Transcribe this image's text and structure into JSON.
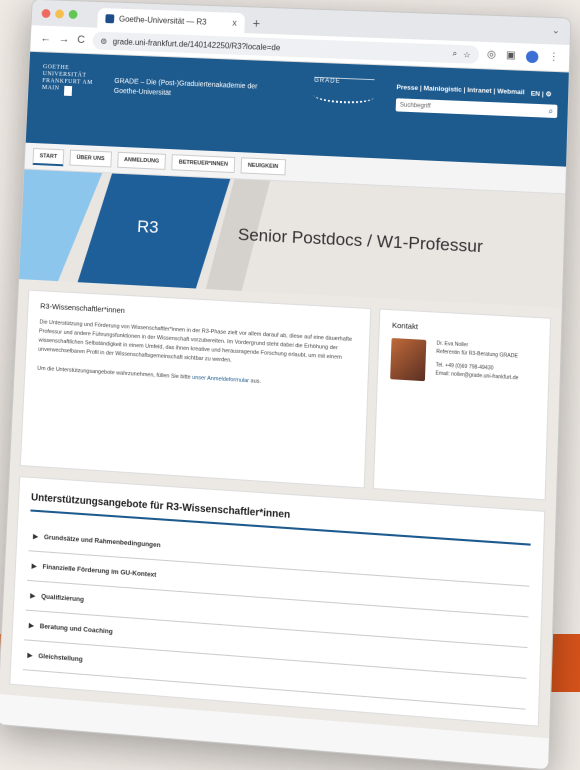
{
  "browser": {
    "tab_title": "Goethe-Universität — R3",
    "tab_close": "x",
    "new_tab": "+",
    "url": "grade.uni-frankfurt.de/140142250/R3?locale=de",
    "nav_icons": [
      "←",
      "→",
      "C"
    ]
  },
  "header": {
    "logo_text": "GOETHE UNIVERSITÄT FRANKFURT AM MAIN",
    "site_title": "GRADE – Die (Post-)Graduiertenakademie der Goethe-Universität",
    "grade_logo": "GRADE",
    "top_links": "Presse | Mainlogistic | Intranet | Webmail",
    "lang": "EN | ⚙",
    "search_placeholder": "Suchbegriff"
  },
  "nav": {
    "items": [
      "START",
      "ÜBER UNS",
      "ANMELDUNG",
      "BETREUER*INNEN",
      "NEUIGKEIN"
    ]
  },
  "hero": {
    "code": "R3",
    "title": "Senior Postdocs / W1-Professur"
  },
  "main": {
    "heading": "R3-Wissenschaftler*innen",
    "paragraph": "Die Unterstützung und Förderung von Wissenschaftler*innen in der R3-Phase zielt vor allem darauf ab, diese auf eine dauerhafte Professur und andere Führungsfunktionen in der Wissenschaft vorzubereiten. Im Vordergrund steht dabei die Erhöhung der wissenschaftlichen Selbständigkeit in einem Umfeld, das ihnen kreative und herausragende Forschung erlaubt, um mit einem unverwechselbaren Profil in der Wissenschaftsgemeinschaft sichtbar zu werden.",
    "cta_before": "Um die Unterstützungsangebote wahrzunehmen, füllen Sie bitte ",
    "cta_link": "unser Anmeldeformular",
    "cta_after": " aus."
  },
  "contact": {
    "heading": "Kontakt",
    "name": "Dr. Eva Noller",
    "role": "Referentin für R3-Beratung GRADE",
    "phone": "Tel. +49 (0)69 798-49430",
    "email": "Email: noller@grade.uni-frankfurt.de"
  },
  "support": {
    "heading": "Unterstützungsangebote für R3-Wissenschaftler*innen",
    "items": [
      "Grundsätze und Rahmenbedingungen",
      "Finanzielle Förderung im GU-Kontext",
      "Qualifizierung",
      "Beratung und Coaching",
      "Gleichstellung"
    ]
  }
}
